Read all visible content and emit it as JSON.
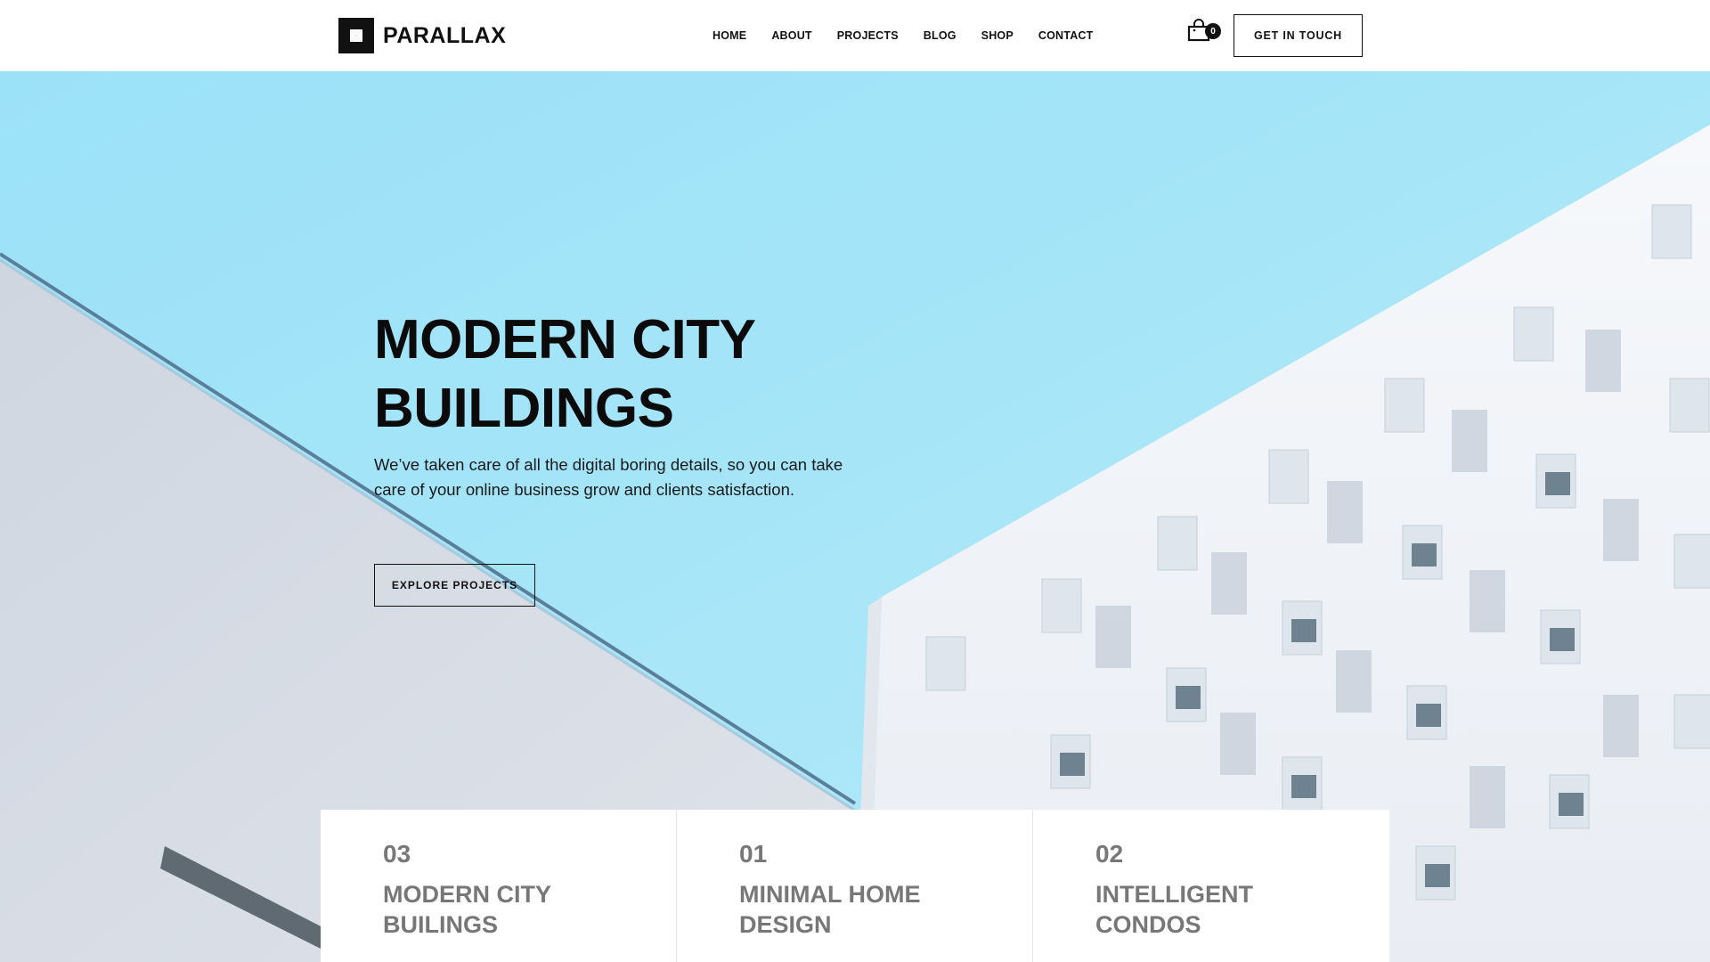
{
  "header": {
    "logo_text": "PARALLAX",
    "nav": [
      "HOME",
      "ABOUT",
      "PROJECTS",
      "BLOG",
      "SHOP",
      "CONTACT"
    ],
    "cart_count": "0",
    "cta_label": "GET IN TOUCH"
  },
  "hero": {
    "title": "MODERN CITY BUILDINGS",
    "text": "We’ve taken care of all the digital boring details, so you can take care of your online business grow and clients satisfaction.",
    "button_label": "EXPLORE PROJECTS"
  },
  "cards": [
    {
      "number": "03",
      "title": "MODERN CITY BUILINGS"
    },
    {
      "number": "01",
      "title": "MINIMAL HOME DESIGN"
    },
    {
      "number": "02",
      "title": "INTELLIGENT CONDOS"
    }
  ],
  "colors": {
    "sky": "#a6e4f7",
    "building_left": "#d6dbe3",
    "building_right": "#eef1f6",
    "text": "#111111",
    "card_text": "#777777"
  },
  "icons": [
    "cart-icon"
  ]
}
